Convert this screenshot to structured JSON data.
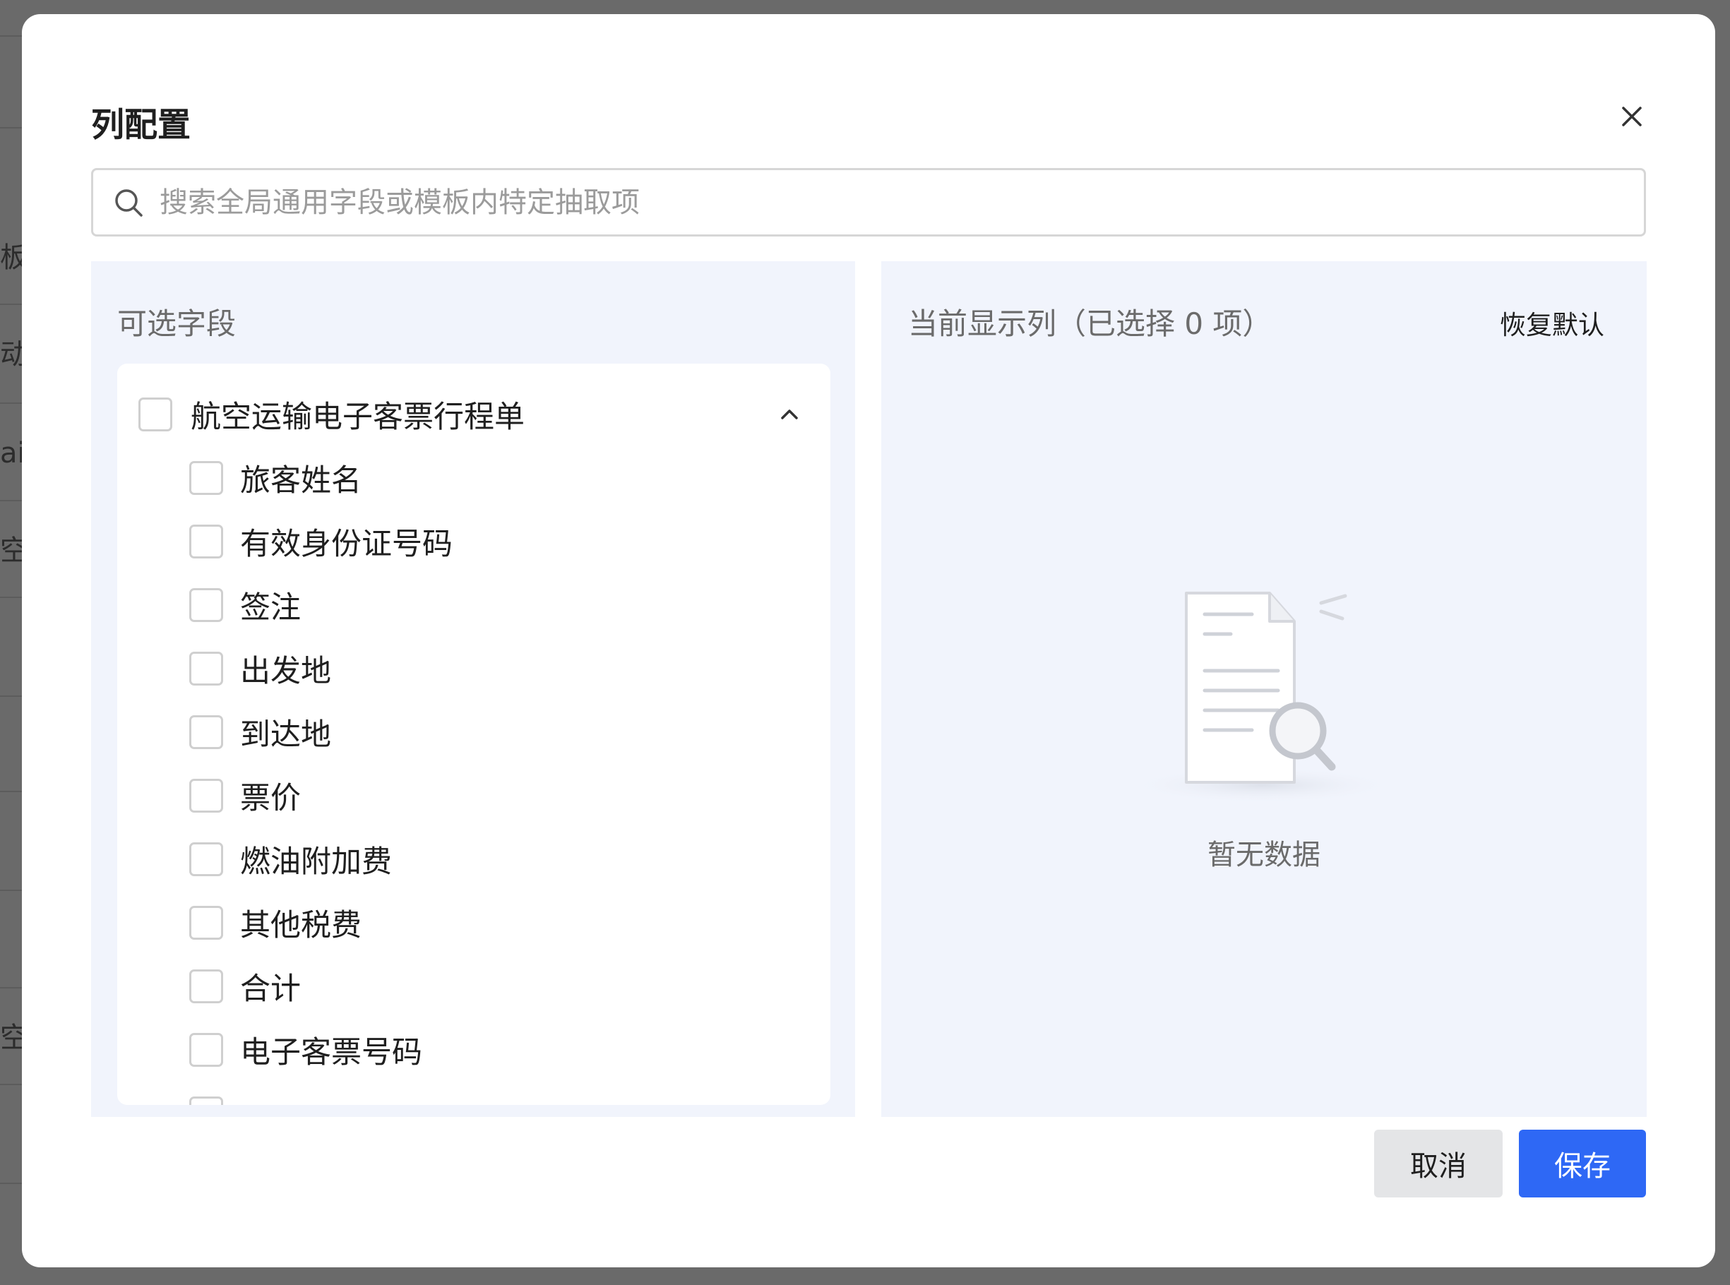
{
  "background": {
    "fragments": [
      "板",
      "动",
      "ai-",
      "空",
      "空"
    ]
  },
  "dialog": {
    "title": "列配置",
    "close_icon": "close-icon",
    "search": {
      "placeholder": "搜索全局通用字段或模板内特定抽取项",
      "value": "",
      "icon": "search-icon"
    },
    "available": {
      "title": "可选字段",
      "group": {
        "label": "航空运输电子客票行程单",
        "checked": false,
        "expanded": true,
        "items": [
          {
            "label": "旅客姓名",
            "checked": false
          },
          {
            "label": "有效身份证号码",
            "checked": false
          },
          {
            "label": "签注",
            "checked": false
          },
          {
            "label": "出发地",
            "checked": false
          },
          {
            "label": "到达地",
            "checked": false
          },
          {
            "label": "票价",
            "checked": false
          },
          {
            "label": "燃油附加费",
            "checked": false
          },
          {
            "label": "其他税费",
            "checked": false
          },
          {
            "label": "合计",
            "checked": false
          },
          {
            "label": "电子客票号码",
            "checked": false
          }
        ]
      }
    },
    "selected": {
      "title": "当前显示列（已选择 0 项）",
      "reset_label": "恢复默认",
      "empty_text": "暂无数据",
      "empty_icon": "empty-document-search-icon"
    },
    "footer": {
      "cancel_label": "取消",
      "save_label": "保存"
    },
    "colors": {
      "primary": "#2e68f5",
      "panel_bg": "#f1f4fc",
      "cancel_bg": "#e4e5e7"
    }
  }
}
